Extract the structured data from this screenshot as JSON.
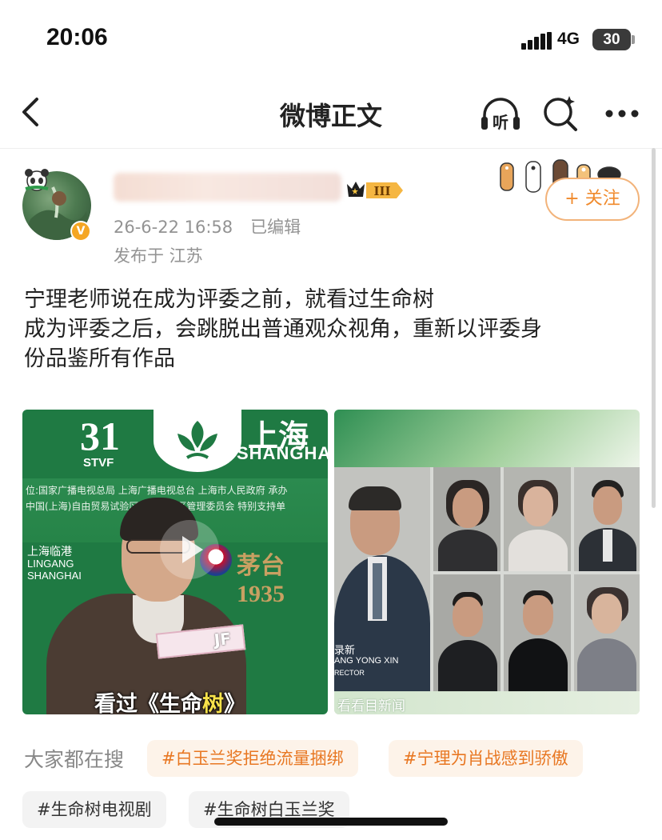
{
  "status_bar": {
    "time": "20:06",
    "network": "4G",
    "battery": "30"
  },
  "nav": {
    "title": "微博正文",
    "icons": [
      "back-icon",
      "listen-icon",
      "search-icon",
      "more-icon"
    ],
    "listen_label": "听"
  },
  "post": {
    "author": {
      "level_badge": "III",
      "verified_badge": "V"
    },
    "timestamp": "26-6-22 16:58",
    "edited": "已编辑",
    "location": "发布于 江苏",
    "follow_label": "+ 关注",
    "text_lines": [
      "宁理老师说在成为评委之前，就看过生命树",
      "成为评委之后，会跳脱出普通观众视角，重新以评委身",
      "份品鉴所有作品"
    ],
    "images": {
      "left": {
        "logo_number": "31",
        "logo_abbr": "STVF",
        "city_cn": "上海",
        "city_en": "SHANGHAI",
        "sponsor_board": [
          "位:国家广播电视总局 上海广播电视总台 上海市人民政府 承办",
          "中国(上海)自由贸易试验区临港新片区管理委员会 特别支持单"
        ],
        "lingang_lines": [
          "上海临港",
          "LINGANG",
          "SHANGHAI"
        ],
        "moutai_text": "茅台1935",
        "card_text": "JF",
        "caption_prefix": "看过《生命",
        "caption_highlight": "树",
        "caption_suffix": "》"
      },
      "right": {
        "director_name": "录新",
        "director_en": "ANG YONG XIN",
        "director_role": "RECTOR",
        "news_text": "看看目新闻"
      }
    }
  },
  "search": {
    "label": "大家都在搜",
    "hot_tags": [
      "#白玉兰奖拒绝流量捆绑",
      "#宁理为肖战感到骄傲"
    ],
    "tags": [
      "#生命树电视剧",
      "#生命树白玉兰奖"
    ]
  },
  "colors": {
    "accent_orange": "#f08a2c",
    "hot_tag_bg": "#fdf3e9",
    "meta_gray": "#939393",
    "festival_green": "#1f7a43"
  }
}
